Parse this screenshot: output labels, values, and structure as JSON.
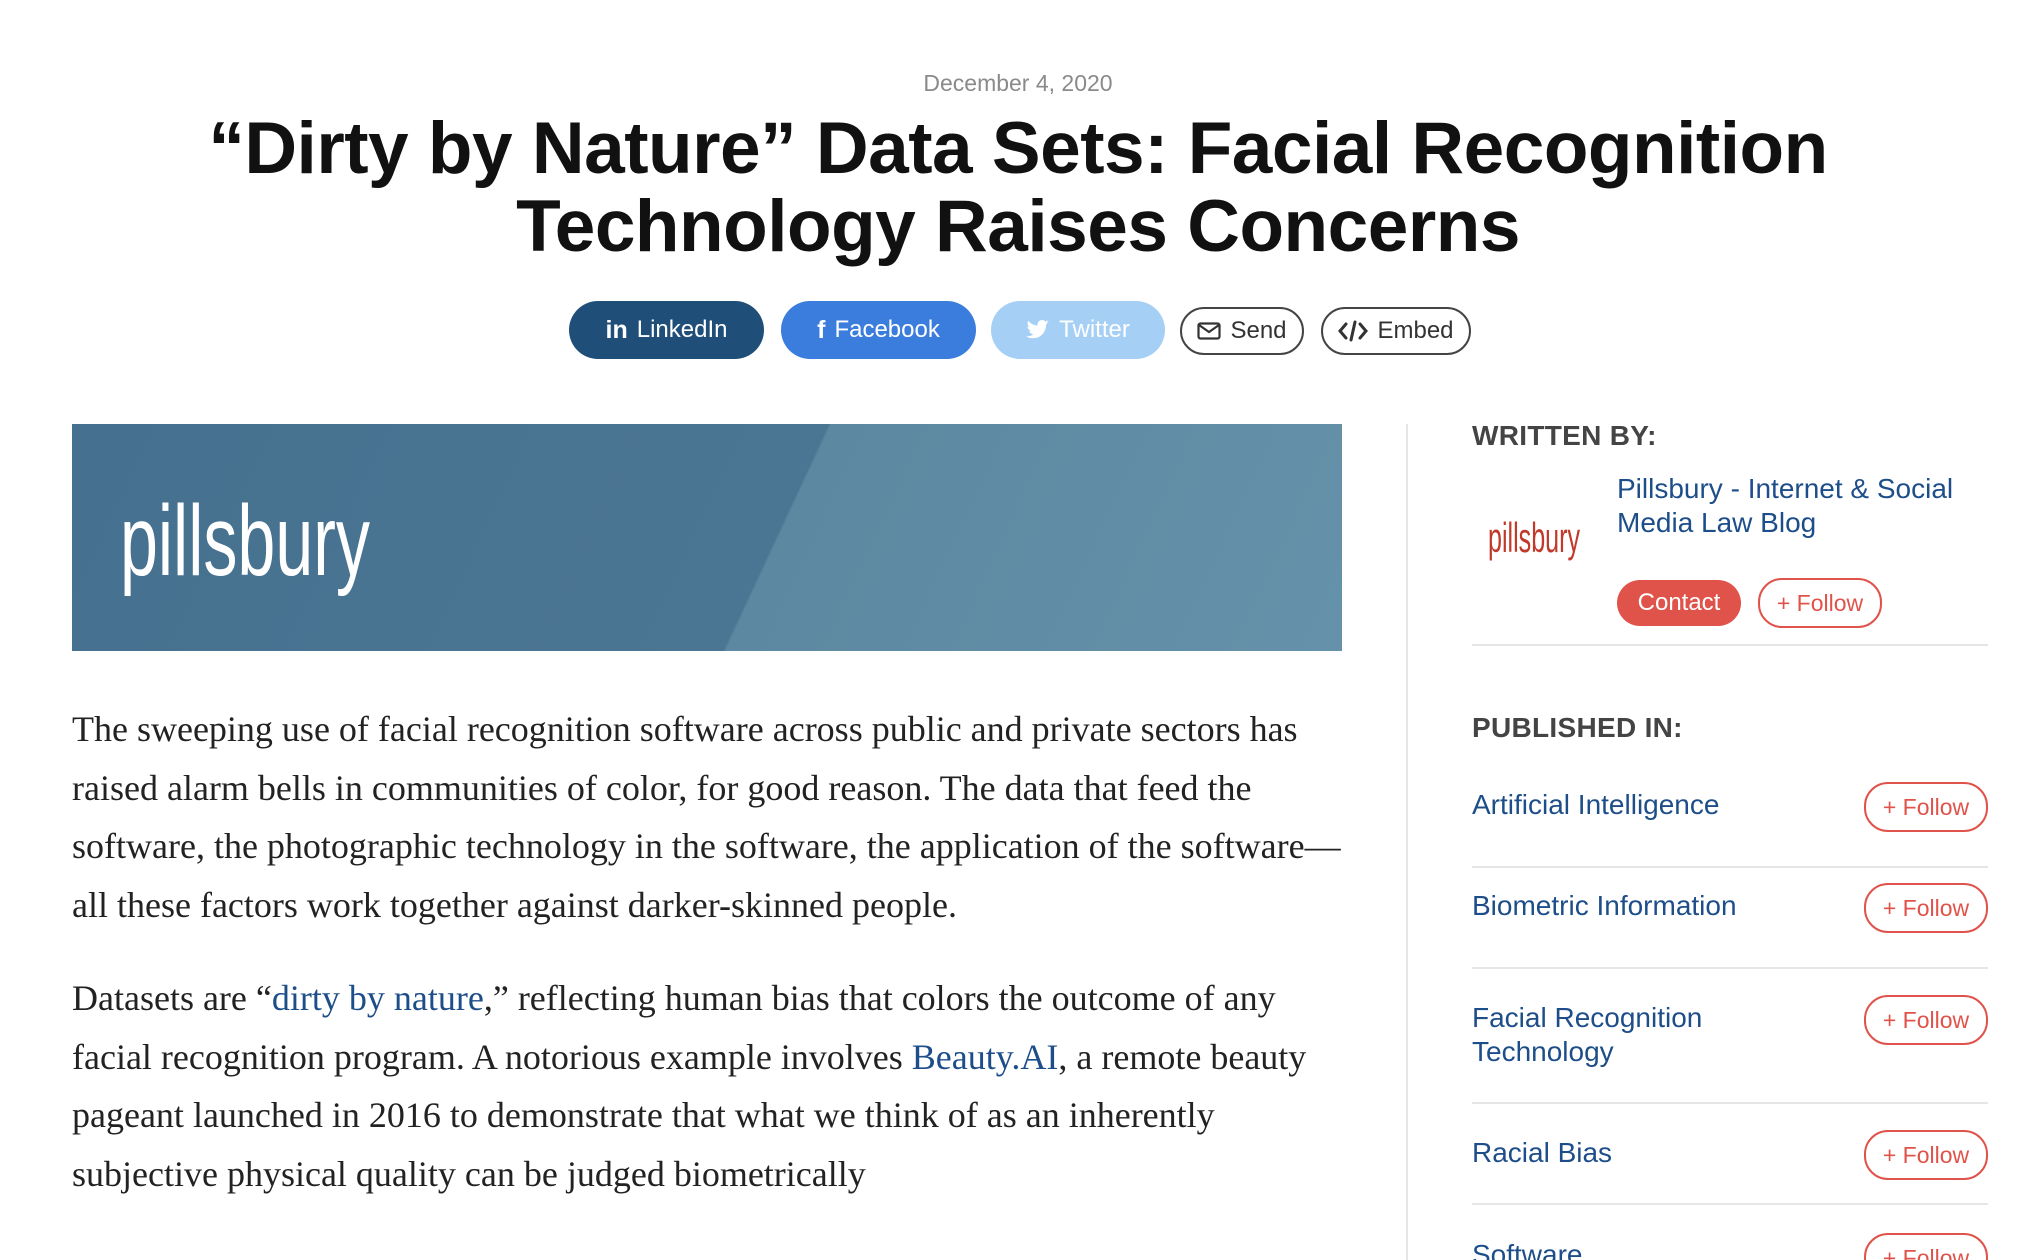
{
  "article": {
    "date": "December 4, 2020",
    "title": "“Dirty by Nature” Data Sets: Facial Recognition Technology Raises Concerns",
    "banner_logo_text": "pillsbury",
    "paragraph1": "The sweeping use of facial recognition software across public and private sectors has raised alarm bells in communities of color, for good reason. The data that feed the software, the photographic technology in the software, the application of the software—all these factors work together against darker-skinned people.",
    "paragraph2": {
      "pre": "Datasets are “",
      "link1": "dirty by nature",
      "mid": ",” reflecting human bias that colors the outcome of any facial recognition program. A notorious example involves ",
      "link2": "Beauty.AI",
      "post": ", a remote beauty pageant launched in 2016 to demonstrate that what we think of as an inherently subjective physical quality can be judged biometrically"
    }
  },
  "share": {
    "linkedin": "LinkedIn",
    "facebook": "Facebook",
    "twitter": "Twitter",
    "send": "Send",
    "embed": "Embed"
  },
  "sidebar": {
    "written_by_heading": "WRITTEN BY:",
    "author_name": "Pillsbury - Internet & Social Media Law Blog",
    "author_logo_text": "pillsbury",
    "contact_label": "Contact",
    "follow_label": "+ Follow",
    "published_in_heading": "PUBLISHED IN:",
    "topics": [
      {
        "label": "Artificial Intelligence",
        "follow": "+ Follow"
      },
      {
        "label": "Biometric Information",
        "follow": "+ Follow"
      },
      {
        "label": "Facial Recognition Technology",
        "follow": "+ Follow"
      },
      {
        "label": "Racial Bias",
        "follow": "+ Follow"
      },
      {
        "label": "Software",
        "follow": "+ Follow"
      }
    ]
  },
  "colors": {
    "linkedin": "#1f4e79",
    "facebook": "#3b7ddd",
    "twitter": "#a6cff5",
    "accent_red": "#e0534a",
    "link_blue": "#1d4e89",
    "banner": "#4b7693"
  },
  "icons": {
    "linkedin": "linkedin-icon",
    "facebook": "facebook-icon",
    "twitter": "twitter-icon",
    "send": "envelope-icon",
    "embed": "code-icon"
  }
}
